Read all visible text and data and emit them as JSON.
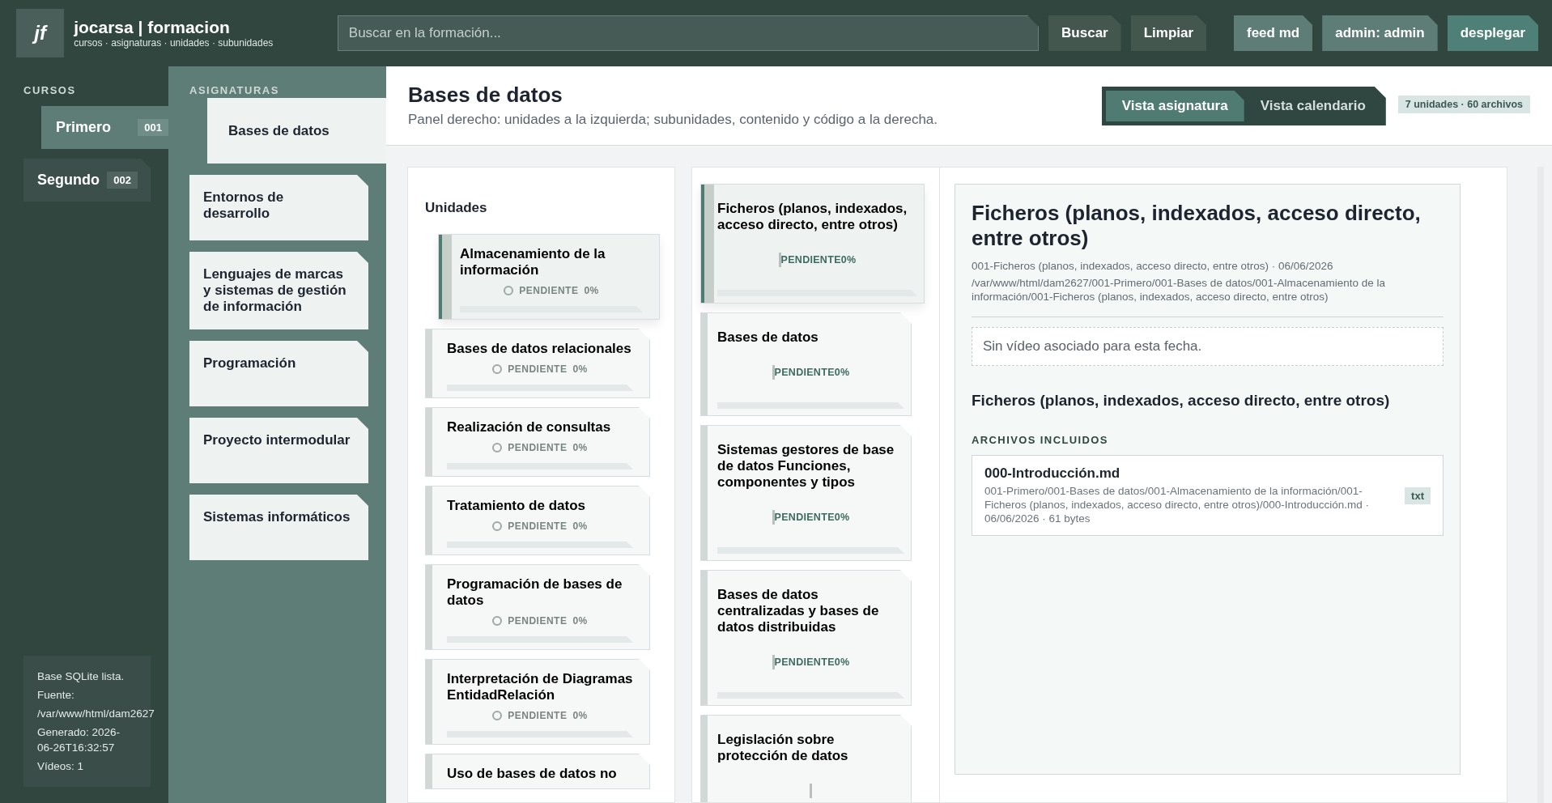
{
  "header": {
    "logo": "jf",
    "title": "jocarsa | formacion",
    "subtitle": "cursos · asignaturas · unidades · subunidades",
    "search": {
      "placeholder": "Buscar en la formación..."
    },
    "buttons": [
      {
        "label": "Buscar",
        "kind": "plain"
      },
      {
        "label": "Limpiar",
        "kind": "plain"
      },
      {
        "label": "feed md",
        "kind": "soft"
      },
      {
        "label": "admin: admin",
        "kind": "soft"
      },
      {
        "label": "desplegar",
        "kind": "accent"
      }
    ]
  },
  "courses": {
    "heading": "CURSOS",
    "items": [
      {
        "label": "Primero",
        "code": "001",
        "selected": true
      },
      {
        "label": "Segundo",
        "code": "002",
        "selected": false
      }
    ],
    "status": [
      "Base SQLite lista.",
      "Fuente:",
      "/var/www/html/dam2627",
      "Generado: 2026-06-26T16:32:57",
      "Vídeos: 1"
    ]
  },
  "subjects": {
    "heading": "ASIGNATURAS",
    "items": [
      {
        "label": "Bases de datos",
        "selected": true
      },
      {
        "label": "Entornos de desarrollo",
        "selected": false
      },
      {
        "label": "Lenguajes de marcas y sistemas de gestión de información",
        "selected": false
      },
      {
        "label": "Programación",
        "selected": false
      },
      {
        "label": "Proyecto intermodular",
        "selected": false
      },
      {
        "label": "Sistemas informáticos",
        "selected": false
      }
    ]
  },
  "main": {
    "title": "Bases de datos",
    "subtitle": "Panel derecho: unidades a la izquierda; subunidades, contenido y código a la derecha.",
    "view_tabs": [
      {
        "label": "Vista asignatura",
        "selected": true
      },
      {
        "label": "Vista calendario",
        "selected": false
      }
    ],
    "badge": "7 unidades · 60 archivos"
  },
  "units": {
    "heading": "Unidades",
    "items": [
      {
        "title": "Almacenamiento de la información",
        "status": "PENDIENTE",
        "percent": "0%",
        "level": 0,
        "selected": true
      },
      {
        "title": "Bases de datos relacionales",
        "status": "PENDIENTE",
        "percent": "0%",
        "level": 0,
        "selected": false
      },
      {
        "title": "Realización de consultas",
        "status": "PENDIENTE",
        "percent": "0%",
        "level": 0,
        "selected": false
      },
      {
        "title": "Tratamiento de datos",
        "status": "PENDIENTE",
        "percent": "0%",
        "level": 0,
        "selected": false
      },
      {
        "title": "Programación de bases de datos",
        "status": "PENDIENTE",
        "percent": "0%",
        "level": 0,
        "selected": false
      },
      {
        "title": "Interpretación de Diagramas EntidadRelación",
        "status": "PENDIENTE",
        "percent": "0%",
        "level": 0,
        "selected": false
      },
      {
        "title": "Uso de bases de datos no",
        "selected": false
      }
    ]
  },
  "subunits": {
    "items": [
      {
        "title": "Ficheros (planos, indexados, acceso directo, entre otros)",
        "status": "PENDIENTE",
        "percent": "0%",
        "level": 0,
        "selected": true
      },
      {
        "title": "Bases de datos",
        "status": "PENDIENTE",
        "percent": "0%",
        "level": 0,
        "selected": false
      },
      {
        "title": "Sistemas gestores de base de datos Funciones, componentes y tipos",
        "status": "PENDIENTE",
        "percent": "0%",
        "level": 0,
        "selected": false
      },
      {
        "title": "Bases de datos centralizadas y bases de datos distribuidas",
        "status": "PENDIENTE",
        "percent": "0%",
        "level": 0,
        "selected": false
      },
      {
        "title": "Legislación sobre protección de datos",
        "selected": false
      }
    ]
  },
  "detail": {
    "title": "Ficheros (planos, indexados, acceso directo, entre otros)",
    "meta": "001-Ficheros (planos, indexados, acceso directo, entre otros) · 06/06/2026",
    "path": "/var/www/html/dam2627/001-Primero/001-Bases de datos/001-Almacenamiento de la información/001-Ficheros (planos, indexados, acceso directo, entre otros)",
    "video_note": "Sin vídeo asociado para esta fecha.",
    "section_title": "Ficheros (planos, indexados, acceso directo, entre otros)",
    "files_heading": "ARCHIVOS INCLUIDOS",
    "files": [
      {
        "name": "000-Introducción.md",
        "path": "001-Primero/001-Bases de datos/001-Almacenamiento de la información/001-Ficheros (planos, indexados, acceso directo, entre otros)/000-Introducción.md · 06/06/2026 · 61 bytes",
        "tag": "txt"
      }
    ]
  }
}
